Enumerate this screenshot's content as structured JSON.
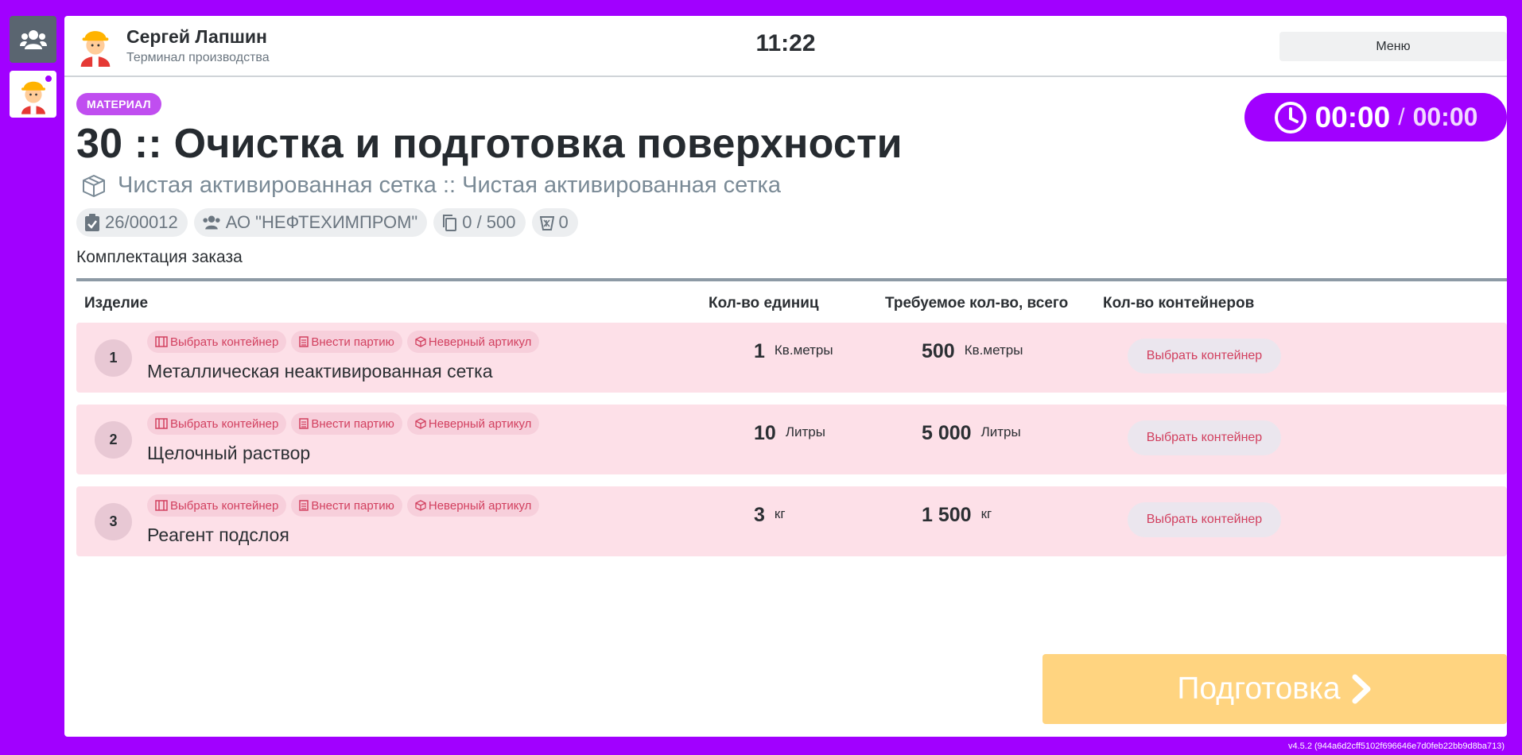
{
  "user": {
    "name": "Сергей Лапшин",
    "role": "Терминал производства"
  },
  "clock": "11:22",
  "menu_label": "Меню",
  "operation": {
    "badge": "МАТЕРИАЛ",
    "title": "30 :: Очистка и подготовка поверхности",
    "product": "Чистая активированная сетка :: Чистая активированная сетка",
    "timer": {
      "elapsed": "00:00",
      "separator": "/",
      "planned": "00:00"
    },
    "chips": {
      "order": "26/00012",
      "customer": "АО \"НЕФТЕХИМПРОМ\"",
      "progress": "0 / 500",
      "waste": "0"
    }
  },
  "section": {
    "title": "Комплектация заказа"
  },
  "table": {
    "headers": {
      "item": "Изделие",
      "units": "Кол-во единиц",
      "required": "Требуемое кол-во, всего",
      "containers": "Кол-во контейнеров"
    },
    "tag_labels": {
      "container": "Выбрать контейнер",
      "batch": "Внести партию",
      "wrong": "Неверный артикул"
    },
    "rows": [
      {
        "num": "1",
        "name": "Металлическая неактивированная сетка",
        "units": "1",
        "units_uom": "Кв.метры",
        "required": "500",
        "required_uom": "Кв.метры",
        "action": "Выбрать контейнер"
      },
      {
        "num": "2",
        "name": "Щелочный раствор",
        "units": "10",
        "units_uom": "Литры",
        "required": "5 000",
        "required_uom": "Литры",
        "action": "Выбрать контейнер"
      },
      {
        "num": "3",
        "name": "Реагент подслоя",
        "units": "3",
        "units_uom": "кг",
        "required": "1 500",
        "required_uom": "кг",
        "action": "Выбрать контейнер"
      }
    ]
  },
  "next_button": "Подготовка",
  "version": "v4.5.2 (944a6d2cff5102f696646e7d0feb22bb9d8ba713)",
  "colors": {
    "accent": "#a100ff",
    "row_bg": "#fde0e8",
    "tag_text": "#d2405f",
    "next_bg": "#ffd480"
  },
  "icons": [
    "users-icon",
    "worker-avatar-icon",
    "clock-icon",
    "box-icon",
    "clipboard-check-icon",
    "users-group-icon",
    "copy-icon",
    "waste-bin-icon",
    "container-icon",
    "list-icon",
    "cube-icon",
    "chevron-right-icon"
  ]
}
